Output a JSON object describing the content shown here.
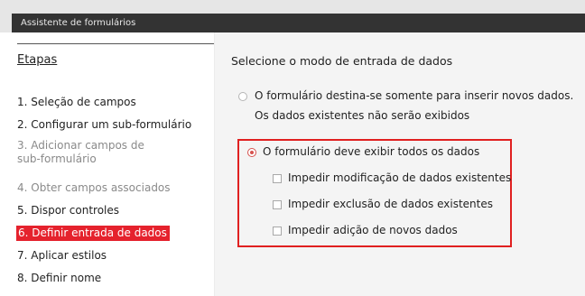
{
  "window": {
    "title": "Assistente de formulários"
  },
  "sidebar": {
    "title": "Etapas",
    "steps": [
      {
        "label": "1. Seleção de campos"
      },
      {
        "label": "2. Configurar um sub-formulário"
      },
      {
        "label": "3. Adicionar campos de sub-formulário"
      },
      {
        "label": "4. Obter campos associados"
      },
      {
        "label": "5. Dispor controles"
      },
      {
        "label": "6. Definir entrada de dados"
      },
      {
        "label": "7. Aplicar estilos"
      },
      {
        "label": "8. Definir nome"
      }
    ]
  },
  "main": {
    "heading": "Selecione o modo de entrada de dados",
    "option_new_only": {
      "label": "O formulário destina-se somente para inserir novos dados.",
      "sublabel": "Os dados existentes não serão exibidos"
    },
    "option_all": {
      "label": "O formulário deve exibir todos os dados"
    },
    "checks": [
      {
        "label": "Impedir modificação de dados existentes"
      },
      {
        "label": "Impedir exclusão de dados existentes"
      },
      {
        "label": "Impedir adição de novos dados"
      }
    ]
  },
  "colors": {
    "accent": "#e5222d",
    "highlight_border": "#e02020"
  }
}
